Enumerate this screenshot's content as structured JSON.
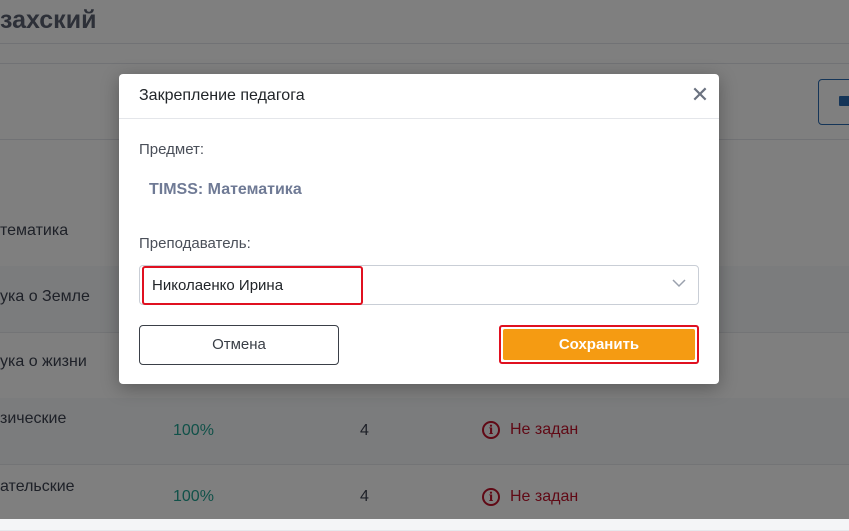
{
  "background": {
    "page_title": "захский",
    "rows": [
      {
        "subject_lines": [
          "тематика"
        ],
        "percent": "",
        "count": "",
        "status": ""
      },
      {
        "subject_lines": [
          "ука о Земле"
        ],
        "percent": "",
        "count": "",
        "status": ""
      },
      {
        "subject_lines": [
          "ука о жизни"
        ],
        "percent": "",
        "count": "",
        "status": ""
      },
      {
        "subject_lines": [
          "зические"
        ],
        "percent": "100%",
        "count": "4",
        "status": "Не задан"
      },
      {
        "subject_lines": [
          "ательские"
        ],
        "percent": "100%",
        "count": "4",
        "status": "Не задан"
      }
    ]
  },
  "modal": {
    "title": "Закрепление педагога",
    "close_symbol": "✕",
    "subject_label": "Предмет:",
    "subject_value": "TIMSS: Математика",
    "teacher_label": "Преподаватель:",
    "teacher_value": "Николаенко Ирина",
    "cancel_label": "Отмена",
    "save_label": "Сохранить"
  },
  "colors": {
    "accent": "#f59b12",
    "highlight": "#e01020",
    "status_error": "#c0132b",
    "percent_ok": "#22a392"
  }
}
